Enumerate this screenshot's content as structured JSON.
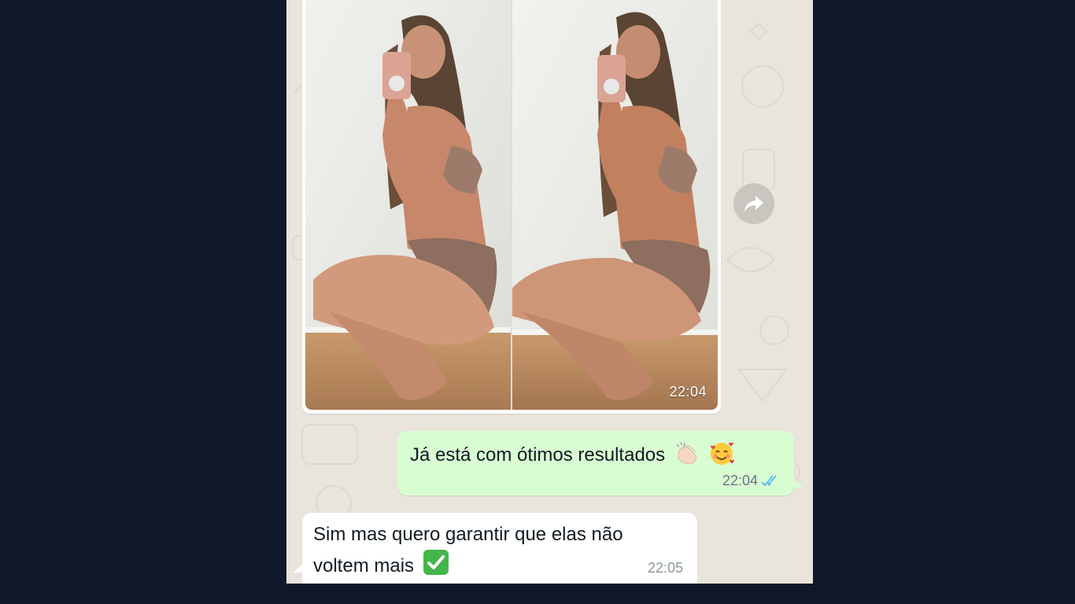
{
  "messages": {
    "image_message": {
      "time": "22:04",
      "forward_icon": "forward-icon"
    },
    "outgoing": {
      "text": "Já está com ótimos resultados",
      "emoji": [
        "clapping-hands-icon",
        "smiling-face-with-hearts-icon"
      ],
      "time": "22:04",
      "status_icon": "double-check-read-icon"
    },
    "incoming": {
      "text_line1": "Sim mas quero garantir que elas não",
      "text_line2": "voltem mais",
      "emoji": "check-mark-button-icon",
      "time": "22:05"
    }
  },
  "colors": {
    "page_background": "#11172b",
    "chat_background": "#e9e4dc",
    "outgoing_bubble": "#d9fdd3",
    "incoming_bubble": "#ffffff",
    "read_ticks": "#53bdeb"
  }
}
